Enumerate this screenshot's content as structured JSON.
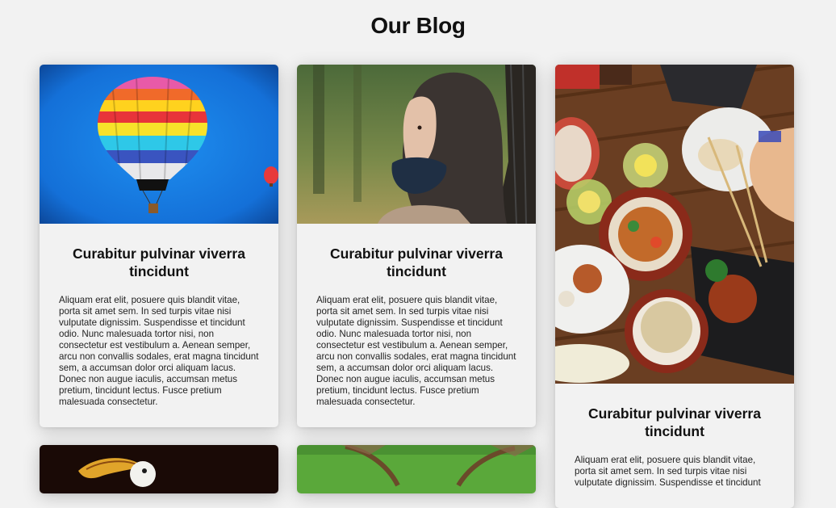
{
  "header": {
    "title": "Our Blog"
  },
  "posts": [
    {
      "image": "hot-air-balloon-photo",
      "title": "Curabitur pulvinar viverra tincidunt",
      "excerpt": "Aliquam erat elit, posuere quis blandit vitae, porta sit amet sem. In sed turpis vitae nisi vulputate dignissim. Suspendisse et tincidunt odio. Nunc malesuada tortor nisi, non consectetur est vestibulum a. Aenean semper, arcu non convallis sodales, erat magna tincidunt sem, a accumsan dolor orci aliquam lacus. Donec non augue iaculis, accumsan metus pretium, tincidunt lectus. Fusce pretium malesuada consectetur."
    },
    {
      "image": "woman-portrait-photo",
      "title": "Curabitur pulvinar viverra tincidunt",
      "excerpt": "Aliquam erat elit, posuere quis blandit vitae, porta sit amet sem. In sed turpis vitae nisi vulputate dignissim. Suspendisse et tincidunt odio. Nunc malesuada tortor nisi, non consectetur est vestibulum a. Aenean semper, arcu non convallis sodales, erat magna tincidunt sem, a accumsan dolor orci aliquam lacus. Donec non augue iaculis, accumsan metus pretium, tincidunt lectus. Fusce pretium malesuada consectetur."
    },
    {
      "image": "food-table-photo",
      "title": "Curabitur pulvinar viverra tincidunt",
      "excerpt": "Aliquam erat elit, posuere quis blandit vitae, porta sit amet sem. In sed turpis vitae nisi vulputate dignissim. Suspendisse et tincidunt"
    },
    {
      "image": "toucan-bird-photo"
    },
    {
      "image": "bird-wings-grass-photo"
    }
  ]
}
